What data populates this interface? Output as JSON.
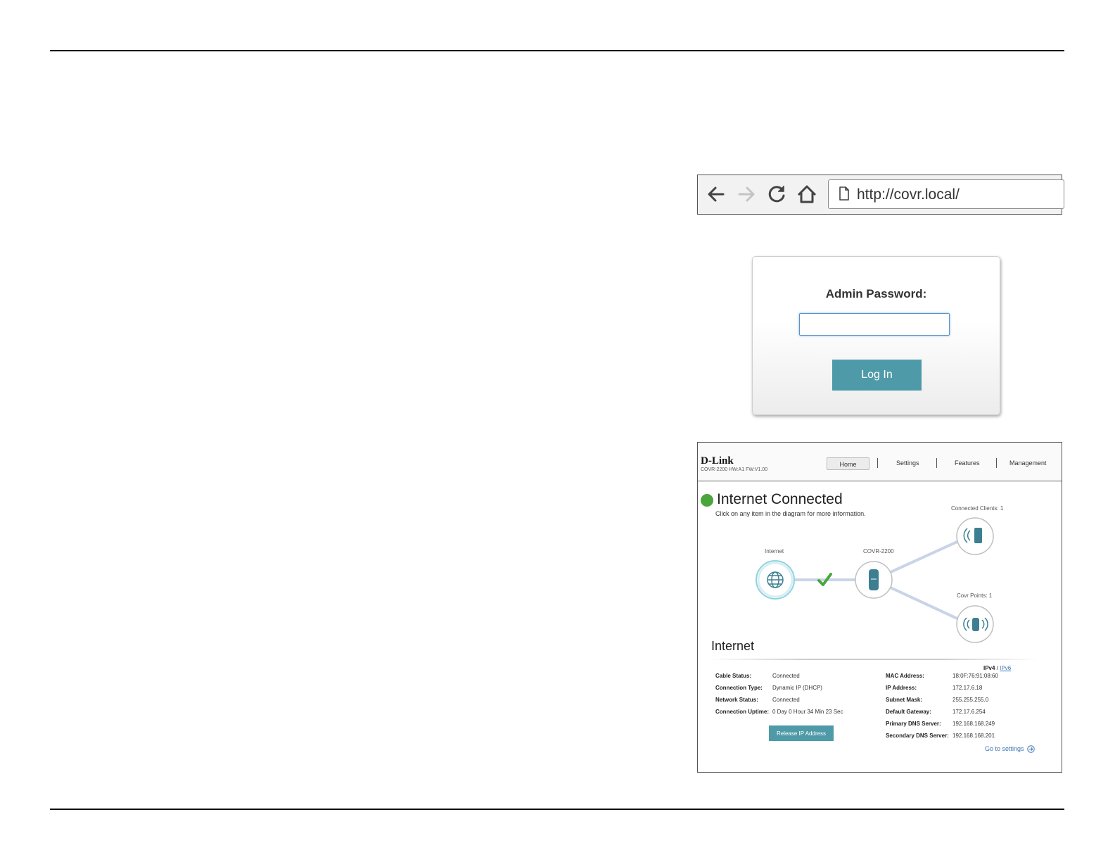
{
  "browser": {
    "url": "http://covr.local/",
    "icons": [
      "back-arrow-icon",
      "forward-arrow-icon",
      "reload-icon",
      "home-icon",
      "page-icon"
    ]
  },
  "login": {
    "label": "Admin Password:",
    "password_value": "",
    "button_label": "Log In"
  },
  "router": {
    "logo": "D-Link",
    "model": "COVR-2200 HW:A1 FW:V1.00",
    "menu": [
      "Home",
      "Settings",
      "Features",
      "Management"
    ],
    "status_title": "Internet Connected",
    "status_subtitle": "Click on any item in the diagram for more information.",
    "diagram": {
      "internet_label": "Internet",
      "device_label": "COVR-2200",
      "clients_label": "Connected Clients: 1",
      "points_label": "Covr Points: 1"
    },
    "section_title": "Internet",
    "ip_version": {
      "v4": "IPv4",
      "sep": "/",
      "v6": "IPv6"
    },
    "left_info": [
      {
        "label": "Cable Status:",
        "value": "Connected"
      },
      {
        "label": "Connection Type:",
        "value": "Dynamic IP (DHCP)"
      },
      {
        "label": "Network Status:",
        "value": "Connected"
      },
      {
        "label": "Connection Uptime:",
        "value": "0 Day 0 Hour 34 Min 23 Sec"
      }
    ],
    "right_info": [
      {
        "label": "MAC Address:",
        "value": "18:0F:76:91:08:60"
      },
      {
        "label": "IP Address:",
        "value": "172.17.6.18"
      },
      {
        "label": "Subnet Mask:",
        "value": "255.255.255.0"
      },
      {
        "label": "Default Gateway:",
        "value": "172.17.6.254"
      },
      {
        "label": "Primary DNS Server:",
        "value": "192.168.168.249"
      },
      {
        "label": "Secondary DNS Server:",
        "value": "192.168.168.201"
      }
    ],
    "release_button": "Release IP Address",
    "goto_settings": "Go to settings",
    "colors": {
      "accent": "#4f9aa8",
      "status_green": "#4aa63c",
      "link": "#3a76b8"
    }
  }
}
